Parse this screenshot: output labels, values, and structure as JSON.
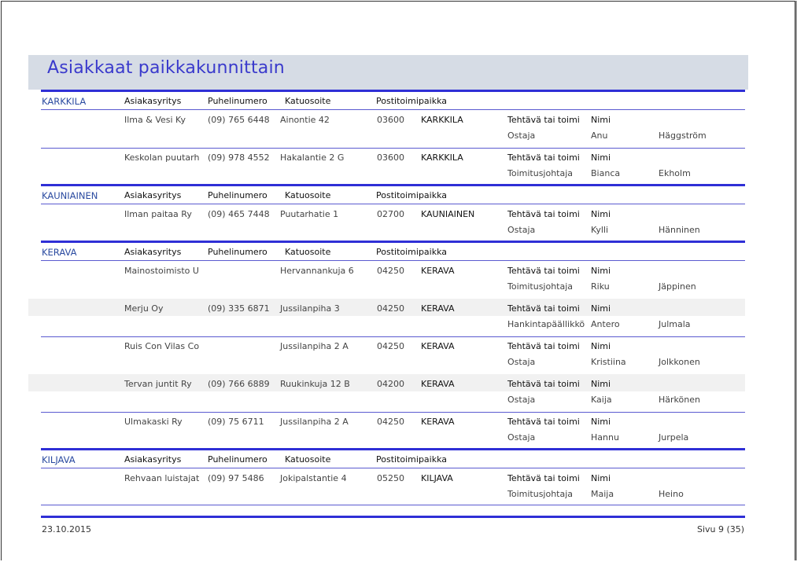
{
  "report": {
    "title": "Asiakkaat paikkakunnittain"
  },
  "headers": {
    "company": "Asiakasyritys",
    "phone": "Puhelinumero",
    "street": "Katuosoite",
    "postal": "Postitoimipaikka",
    "role": "Tehtävä tai toimi",
    "name": "Nimi"
  },
  "groups": [
    {
      "city": "KARKKILA",
      "customers": [
        {
          "company": "Ilma & Vesi Ky",
          "phone": "(09) 765 6448",
          "street": "Ainontie 42",
          "zip": "03600",
          "town": "KARKKILA",
          "role": "Ostaja",
          "first": "Anu",
          "last": "Häggström"
        },
        {
          "company": "Keskolan puutarh",
          "phone": "(09) 978 4552",
          "street": "Hakalantie 2 G",
          "zip": "03600",
          "town": "KARKKILA",
          "role": "Toimitusjohtaja",
          "first": "Bianca",
          "last": "Ekholm"
        }
      ]
    },
    {
      "city": "KAUNIAINEN",
      "customers": [
        {
          "company": "Ilman paitaa Ry",
          "phone": "(09) 465 7448",
          "street": "Puutarhatie 1",
          "zip": "02700",
          "town": "KAUNIAINEN",
          "role": "Ostaja",
          "first": "Kylli",
          "last": "Hänninen"
        }
      ]
    },
    {
      "city": "KERAVA",
      "customers": [
        {
          "company": "Mainostoimisto U",
          "phone": "",
          "street": "Hervannankuja 6",
          "zip": "04250",
          "town": "KERAVA",
          "role": "Toimitusjohtaja",
          "first": "Riku",
          "last": "Jäppinen"
        },
        {
          "company": "Merju Oy",
          "phone": "(09) 335 6871",
          "street": "Jussilanpiha 3",
          "zip": "04250",
          "town": "KERAVA",
          "role": "Hankintapäällikkö",
          "first": "Antero",
          "last": "Julmala"
        },
        {
          "company": "Ruis Con Vilas Co",
          "phone": "",
          "street": "Jussilanpiha 2 A",
          "zip": "04250",
          "town": "KERAVA",
          "role": "Ostaja",
          "first": "Kristiina",
          "last": "Jolkkonen"
        },
        {
          "company": "Tervan juntit Ry",
          "phone": "(09) 766 6889",
          "street": "Ruukinkuja 12 B",
          "zip": "04200",
          "town": "KERAVA",
          "role": "Ostaja",
          "first": "Kaija",
          "last": "Härkönen"
        },
        {
          "company": "Ulmakaski Ry",
          "phone": "(09) 75 6711",
          "street": "Jussilanpiha 2 A",
          "zip": "04250",
          "town": "KERAVA",
          "role": "Ostaja",
          "first": "Hannu",
          "last": "Jurpela"
        }
      ]
    },
    {
      "city": "KILJAVA",
      "customers": [
        {
          "company": "Rehvaan luistajat",
          "phone": "(09) 97 5486",
          "street": "Jokipalstantie 4",
          "zip": "05250",
          "town": "KILJAVA",
          "role": "Toimitusjohtaja",
          "first": "Maija",
          "last": "Heino"
        }
      ]
    }
  ],
  "footer": {
    "date": "23.10.2015",
    "page": "Sivu 9 (35)"
  }
}
